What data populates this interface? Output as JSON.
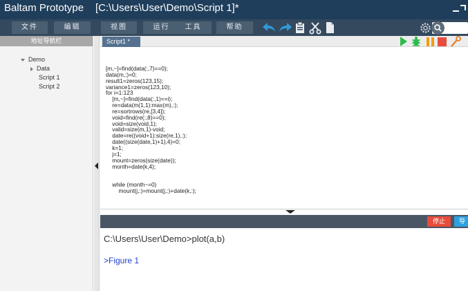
{
  "titlebar": {
    "app_name": "Baltam Prototype",
    "file_path": "[C:\\Users\\User\\Demo\\Script 1]*"
  },
  "menu": {
    "file": "文件",
    "edit": "编辑",
    "view": "视图",
    "run": "运行",
    "tools": "工具",
    "help": "帮助"
  },
  "toolbar_icons": [
    "undo-icon",
    "redo-icon",
    "clipboard-icon",
    "scissors-icon",
    "copy-icon",
    "gear-icon",
    "search-icon"
  ],
  "run_icons": [
    "run-icon",
    "debug-icon",
    "pause-icon",
    "stop-icon",
    "wrench-icon"
  ],
  "sidebar": {
    "header": "地址导航栏",
    "tree": [
      {
        "label": "Demo",
        "expanded": true
      },
      {
        "label": "Data",
        "expanded": false
      },
      {
        "label": "Script 1"
      },
      {
        "label": "Script 2"
      }
    ]
  },
  "editor": {
    "tab_label": "Script1 *",
    "code_lines": [
      "[m,~]=find(data(:,7)==0);",
      "data(m,:)=0;",
      "result1=zeros(123,15);",
      "variance1=zeros(123,10);",
      "for i=1:123",
      "    [m,~]=find(data(:,1)==i);",
      "    re=data(m(1,1):max(m),:);",
      "    re=sortrows(re,[3,4]);",
      "    void=find(re(:,8)==0);",
      "    void=size(void,1);",
      "    valid=size(m,1)-void;",
      "    date=re((void+1):size(re,1),:);",
      "    date((size(date,1)+1),4)=0;",
      "    k=1;",
      "    j=1;",
      "    mount=zeros(size(date));",
      "    month=date(k,4);",
      "",
      "",
      "    while (month~=0)",
      "        mount(j,:)=mount(j,:)+date(k,:);"
    ]
  },
  "console": {
    "stop_label": "停止",
    "guide_label": "导",
    "prompt_text": "C:\\Users\\User\\Demo>plot(a,b)",
    "figure_text": ">Figure 1"
  },
  "colors": {
    "titlebar": "#1f3e5b",
    "menubar": "#34495e",
    "menu_button": "#4b5f73",
    "toolbar_icon": "#2e9ad6",
    "run_green": "#2dbb4d",
    "pause_orange": "#f39c12",
    "stop_red": "#e74c3c",
    "tab": "#55718f",
    "console_bar": "#4a5663",
    "figure_link": "#1f3ecf"
  }
}
